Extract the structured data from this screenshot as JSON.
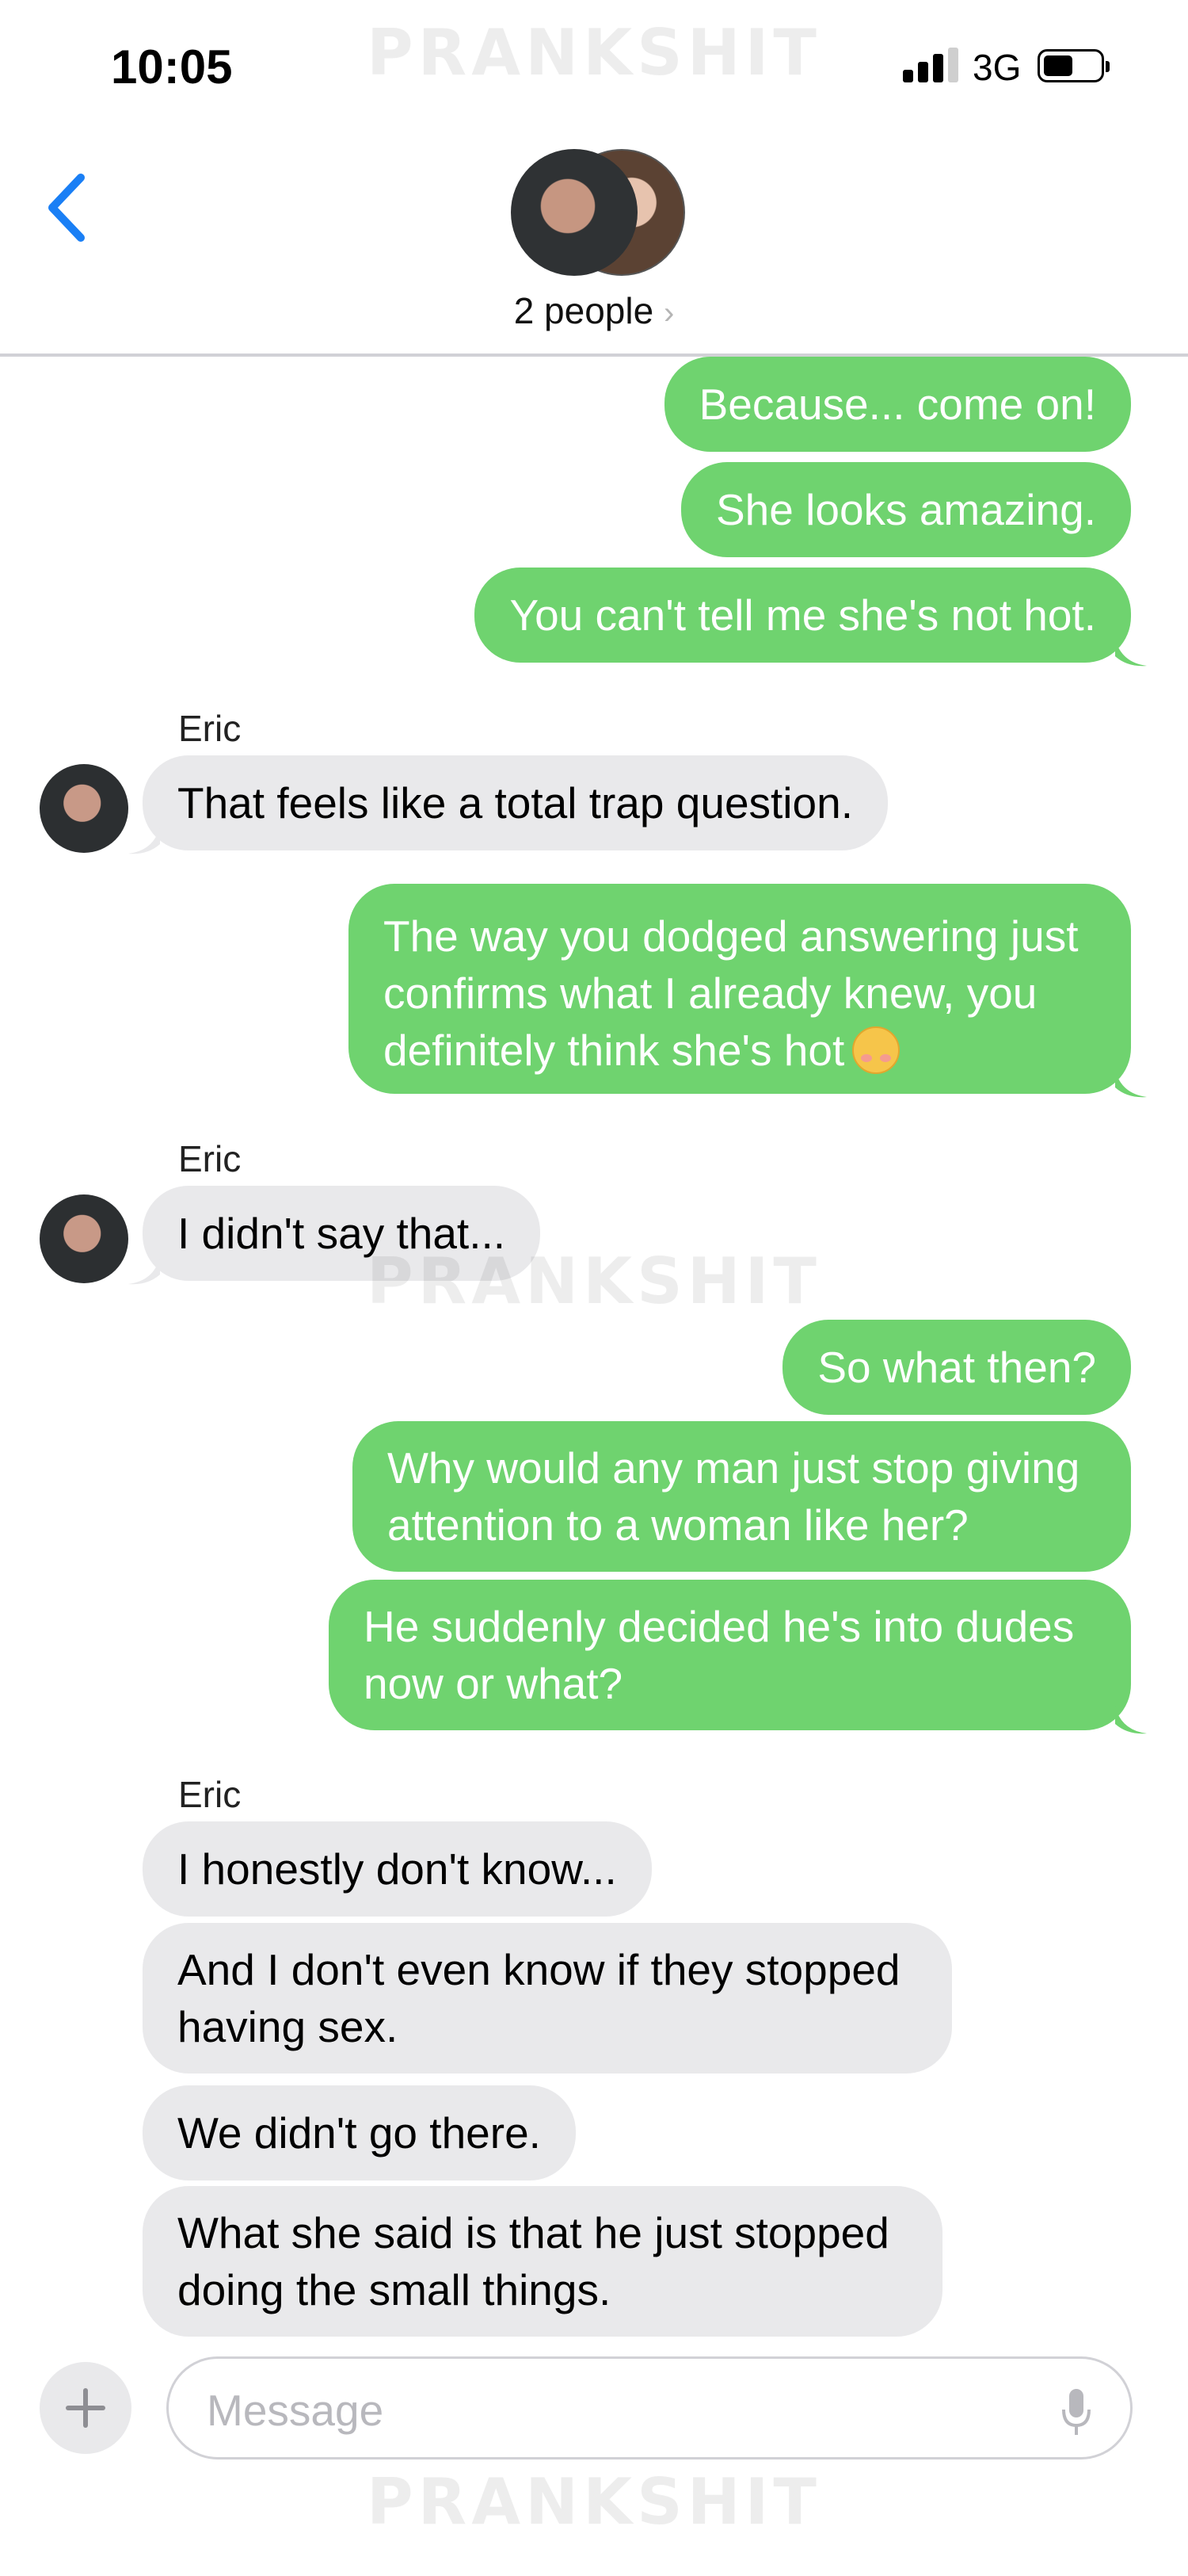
{
  "watermark": "PRANKSHIT",
  "status_bar": {
    "time": "10:05",
    "network": "3G"
  },
  "header": {
    "participants_label": "2 people",
    "chevron": "›"
  },
  "messages": [
    {
      "from": "me",
      "text": "Because... come on!"
    },
    {
      "from": "me",
      "text": "She looks amazing."
    },
    {
      "from": "me",
      "text": "You can't tell me she's not hot."
    },
    {
      "from": "Eric",
      "sender_label": "Eric",
      "text": "That feels like a total trap question."
    },
    {
      "from": "me",
      "lines": [
        "The way you dodged answering just",
        "confirms what I already knew, you",
        "definitely think she's hot"
      ],
      "emoji": "smirk-emoji"
    },
    {
      "from": "Eric",
      "sender_label": "Eric",
      "text": "I didn't say that..."
    },
    {
      "from": "me",
      "text": "So what then?"
    },
    {
      "from": "me",
      "lines": [
        "Why would any man just stop giving",
        "attention to a woman like her?"
      ]
    },
    {
      "from": "me",
      "lines": [
        "He suddenly decided he's into dudes",
        "now or what?"
      ]
    },
    {
      "from": "Eric",
      "sender_label": "Eric",
      "text": "I honestly don't know..."
    },
    {
      "from": "Eric",
      "lines": [
        "And I don't even know if they stopped",
        "having sex."
      ]
    },
    {
      "from": "Eric",
      "text": "We didn't go there."
    },
    {
      "from": "Eric",
      "lines": [
        "What she said is that he just stopped",
        "doing the small things."
      ]
    }
  ],
  "composer": {
    "placeholder": "Message"
  },
  "colors": {
    "sent_bubble": "#6fd36f",
    "received_bubble": "#e9e9eb",
    "accent": "#1a7ff5"
  }
}
